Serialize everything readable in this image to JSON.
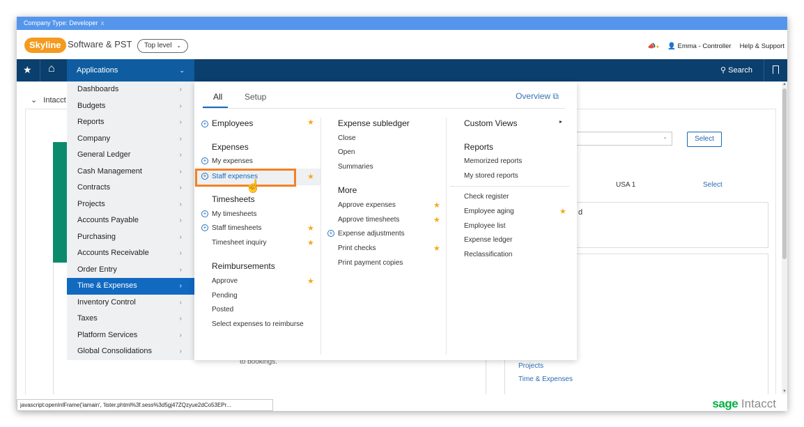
{
  "company_bar": {
    "text": "Company Type: Developer",
    "close": "x"
  },
  "header": {
    "logo": "Skyline",
    "app_name": "Software & PST",
    "level": "Top level",
    "user": "Emma - Controller",
    "help": "Help & Support"
  },
  "nav": {
    "applications": "Applications",
    "search": "Search"
  },
  "background": {
    "collapse_title": "Intacct",
    "country": "USA 1",
    "select_link": "Select",
    "select_button": "Select",
    "partial_text": "d",
    "bookings": "to bookings.",
    "links": [
      "Projects",
      "Time & Expenses"
    ]
  },
  "sidebar": {
    "items": [
      {
        "label": "Dashboards"
      },
      {
        "label": "Budgets"
      },
      {
        "label": "Reports"
      },
      {
        "label": "Company"
      },
      {
        "label": "General Ledger"
      },
      {
        "label": "Cash Management"
      },
      {
        "label": "Contracts"
      },
      {
        "label": "Projects"
      },
      {
        "label": "Accounts Payable"
      },
      {
        "label": "Purchasing"
      },
      {
        "label": "Accounts Receivable"
      },
      {
        "label": "Order Entry"
      },
      {
        "label": "Time & Expenses"
      },
      {
        "label": "Inventory Control"
      },
      {
        "label": "Taxes"
      },
      {
        "label": "Platform Services"
      },
      {
        "label": "Global Consolidations"
      }
    ],
    "active": "Time & Expenses"
  },
  "menu": {
    "tabs": [
      "All",
      "Setup"
    ],
    "overview": "Overview",
    "col1": {
      "employees": "Employees",
      "expenses_heading": "Expenses",
      "my_expenses": "My expenses",
      "staff_expenses": "Staff expenses",
      "timesheets_heading": "Timesheets",
      "my_timesheets": "My timesheets",
      "staff_timesheets": "Staff timesheets",
      "timesheet_inquiry": "Timesheet inquiry",
      "reimbursements_heading": "Reimbursements",
      "approve": "Approve",
      "pending": "Pending",
      "posted": "Posted",
      "select_reimburse": "Select expenses to reimburse"
    },
    "col2": {
      "subledger_heading": "Expense subledger",
      "close": "Close",
      "open": "Open",
      "summaries": "Summaries",
      "more_heading": "More",
      "approve_expenses": "Approve expenses",
      "approve_timesheets": "Approve timesheets",
      "expense_adjustments": "Expense adjustments",
      "print_checks": "Print checks",
      "print_payment_copies": "Print payment copies"
    },
    "col3": {
      "custom_views": "Custom Views",
      "reports_heading": "Reports",
      "memorized_reports": "Memorized reports",
      "my_stored_reports": "My stored reports",
      "check_register": "Check register",
      "employee_aging": "Employee aging",
      "employee_list": "Employee list",
      "expense_ledger": "Expense ledger",
      "reclassification": "Reclassification"
    }
  },
  "status": {
    "url": "javascript:openInlFrame('iamain', 'lister.phtml%3f.sess%3d5gj47ZQzyue2dCo53EPr..."
  },
  "brand": {
    "sage": "sage",
    "intacct": "Intacct"
  },
  "colors": {
    "nav": "#0b3f6d",
    "active": "#1169c0",
    "company_bar": "#5596ec",
    "favorite": "#f4a81d",
    "highlight": "#f58025",
    "brand_green": "#00b140"
  }
}
